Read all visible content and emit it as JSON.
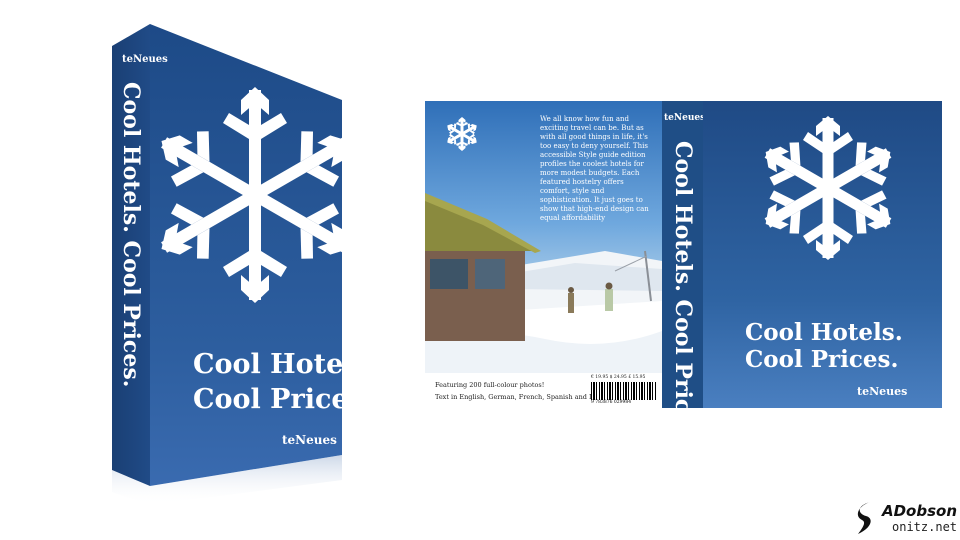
{
  "book": {
    "title_line1": "Cool Hotels.",
    "title_line2": "Cool Prices.",
    "spine_title": "Cool Hotels. Cool Prices.",
    "publisher": "teNeues",
    "blurb": "We all know how fun and exciting travel can be. But as with all good things in life, it's too easy to deny yourself. This accessible Style guide edition profiles the coolest hotels for more modest budgets. Each featured hostelry offers comfort, style and sophistication. It just goes to show that high-end design can equal affordability",
    "footer_line1": "Featuring 200 full-colour photos!",
    "footer_line2": "Text in English, German, French, Spanish and Italian",
    "prices": "€ 19.95    $ 24.95    £ 15.95",
    "isbn": "9 783876 029984"
  },
  "signature": {
    "name": "ADobson",
    "site": "onitz.net"
  },
  "colors": {
    "cover_blue": "#2a5a9a",
    "spine_blue": "#1f4e86",
    "snowflake": "#ffffff"
  },
  "icons": {
    "snowflake": "snowflake-icon"
  }
}
